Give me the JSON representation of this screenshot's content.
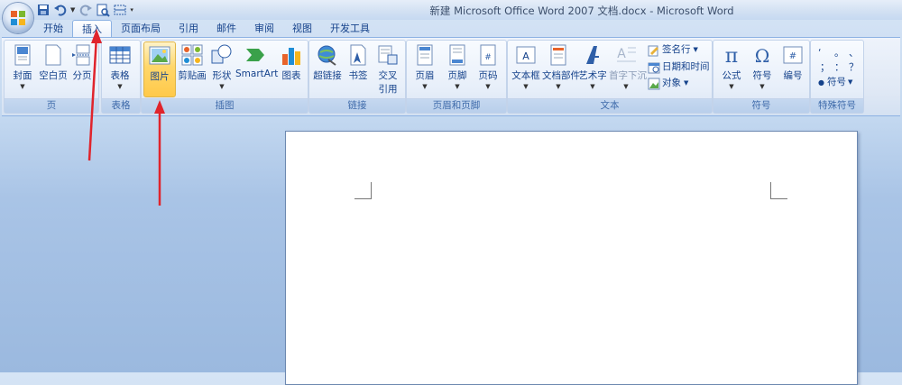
{
  "window": {
    "title": "新建 Microsoft Office Word 2007 文档.docx - Microsoft Word"
  },
  "tabs": [
    "开始",
    "插入",
    "页面布局",
    "引用",
    "邮件",
    "审阅",
    "视图",
    "开发工具"
  ],
  "active_tab": "插入",
  "groups": {
    "page": {
      "label": "页",
      "buttons": {
        "cover": "封面",
        "blank": "空白页",
        "break": "分页"
      }
    },
    "table": {
      "label": "表格",
      "buttons": {
        "table": "表格"
      }
    },
    "illustrations": {
      "label": "插图",
      "buttons": {
        "picture": "图片",
        "clipart": "剪贴画",
        "shapes": "形状",
        "smartart": "SmartArt",
        "chart": "图表"
      }
    },
    "links": {
      "label": "链接",
      "buttons": {
        "hyperlink": "超链接",
        "bookmark": "书签",
        "crossref1": "交叉",
        "crossref2": "引用"
      }
    },
    "header_footer": {
      "label": "页眉和页脚",
      "buttons": {
        "header": "页眉",
        "footer": "页脚",
        "page_number": "页码"
      }
    },
    "text": {
      "label": "文本",
      "buttons": {
        "textbox": "文本框",
        "quickparts": "文档部件",
        "wordart": "艺术字",
        "dropcap": "首字下沉",
        "signature": "签名行",
        "datetime": "日期和时间",
        "object": "对象"
      }
    },
    "symbols": {
      "label": "符号",
      "buttons": {
        "equation": "公式",
        "symbol": "符号",
        "number": "编号"
      }
    },
    "special": {
      "label": "特殊符号",
      "marks": [
        "‘",
        "。",
        "、",
        "；",
        "：",
        "？",
        "●"
      ],
      "symbol_dropdown": "符号"
    }
  },
  "colors": {
    "accent_tab_border": "#8db2e3",
    "selected_button": "#ffd76a",
    "annotation_arrow": "#e0242c"
  }
}
